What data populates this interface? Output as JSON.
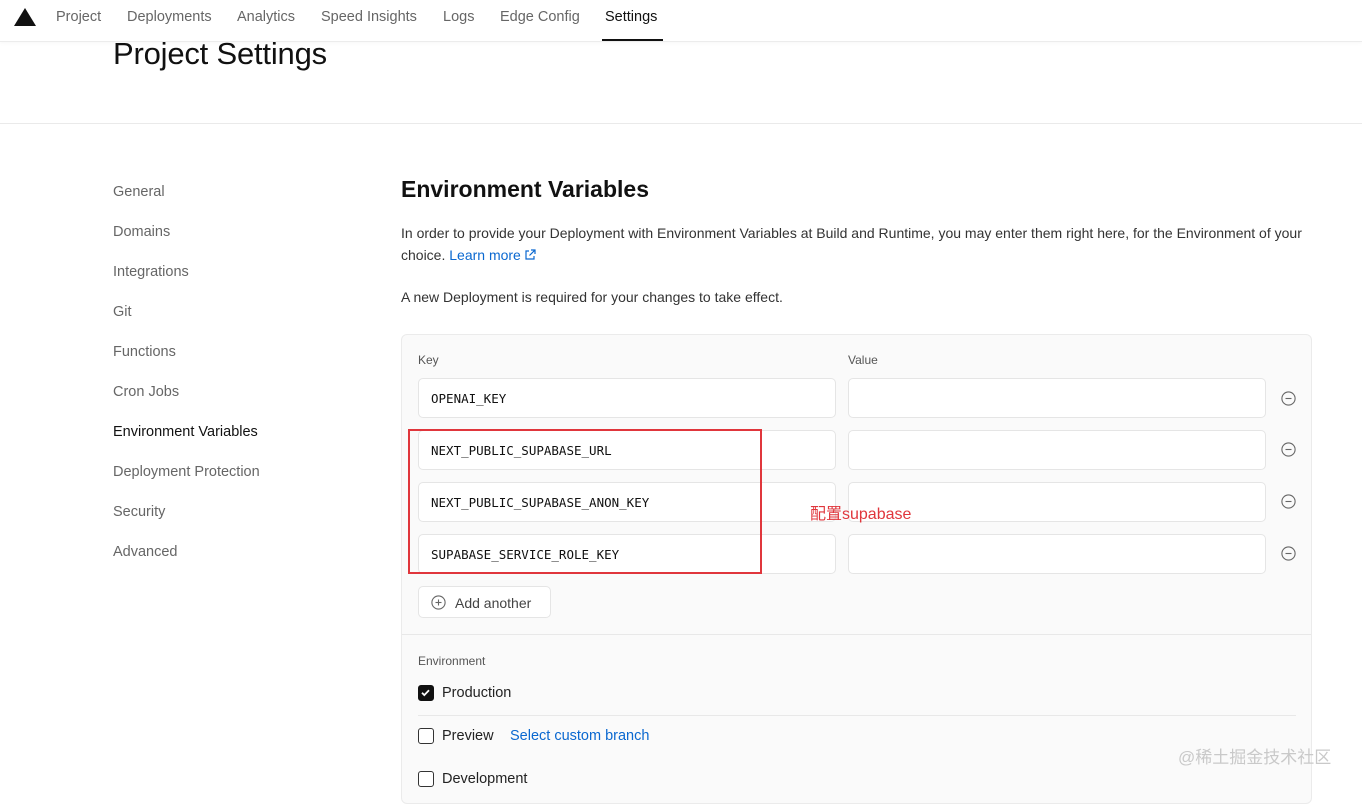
{
  "nav": {
    "tabs": [
      {
        "label": "Project"
      },
      {
        "label": "Deployments"
      },
      {
        "label": "Analytics"
      },
      {
        "label": "Speed Insights"
      },
      {
        "label": "Logs"
      },
      {
        "label": "Edge Config"
      },
      {
        "label": "Settings",
        "active": true
      }
    ]
  },
  "page": {
    "title": "Project Settings"
  },
  "sidebar": {
    "items": [
      {
        "label": "General"
      },
      {
        "label": "Domains"
      },
      {
        "label": "Integrations"
      },
      {
        "label": "Git"
      },
      {
        "label": "Functions"
      },
      {
        "label": "Cron Jobs"
      },
      {
        "label": "Environment Variables",
        "active": true
      },
      {
        "label": "Deployment Protection"
      },
      {
        "label": "Security"
      },
      {
        "label": "Advanced"
      }
    ]
  },
  "env": {
    "title": "Environment Variables",
    "description": "In order to provide your Deployment with Environment Variables at Build and Runtime, you may enter them right here, for the Environment of your choice.",
    "learn_more": "Learn more",
    "note": "A new Deployment is required for your changes to take effect.",
    "key_label": "Key",
    "value_label": "Value",
    "rows": [
      {
        "key": "OPENAI_KEY",
        "value": ""
      },
      {
        "key": "NEXT_PUBLIC_SUPABASE_URL",
        "value": ""
      },
      {
        "key": "NEXT_PUBLIC_SUPABASE_ANON_KEY",
        "value": ""
      },
      {
        "key": "SUPABASE_SERVICE_ROLE_KEY",
        "value": ""
      }
    ],
    "add_another": "Add another",
    "environment_label": "Environment",
    "environments": [
      {
        "label": "Production",
        "checked": true
      },
      {
        "label": "Preview",
        "checked": false
      },
      {
        "label": "Development",
        "checked": false
      }
    ],
    "custom_branch_link": "Select custom branch"
  },
  "annotation": {
    "text": "配置supabase",
    "color": "#e0363c"
  },
  "watermark": "@稀土掘金技术社区",
  "colors": {
    "link": "#0a68d0",
    "annotation": "#e0363c",
    "text": "#111111"
  }
}
